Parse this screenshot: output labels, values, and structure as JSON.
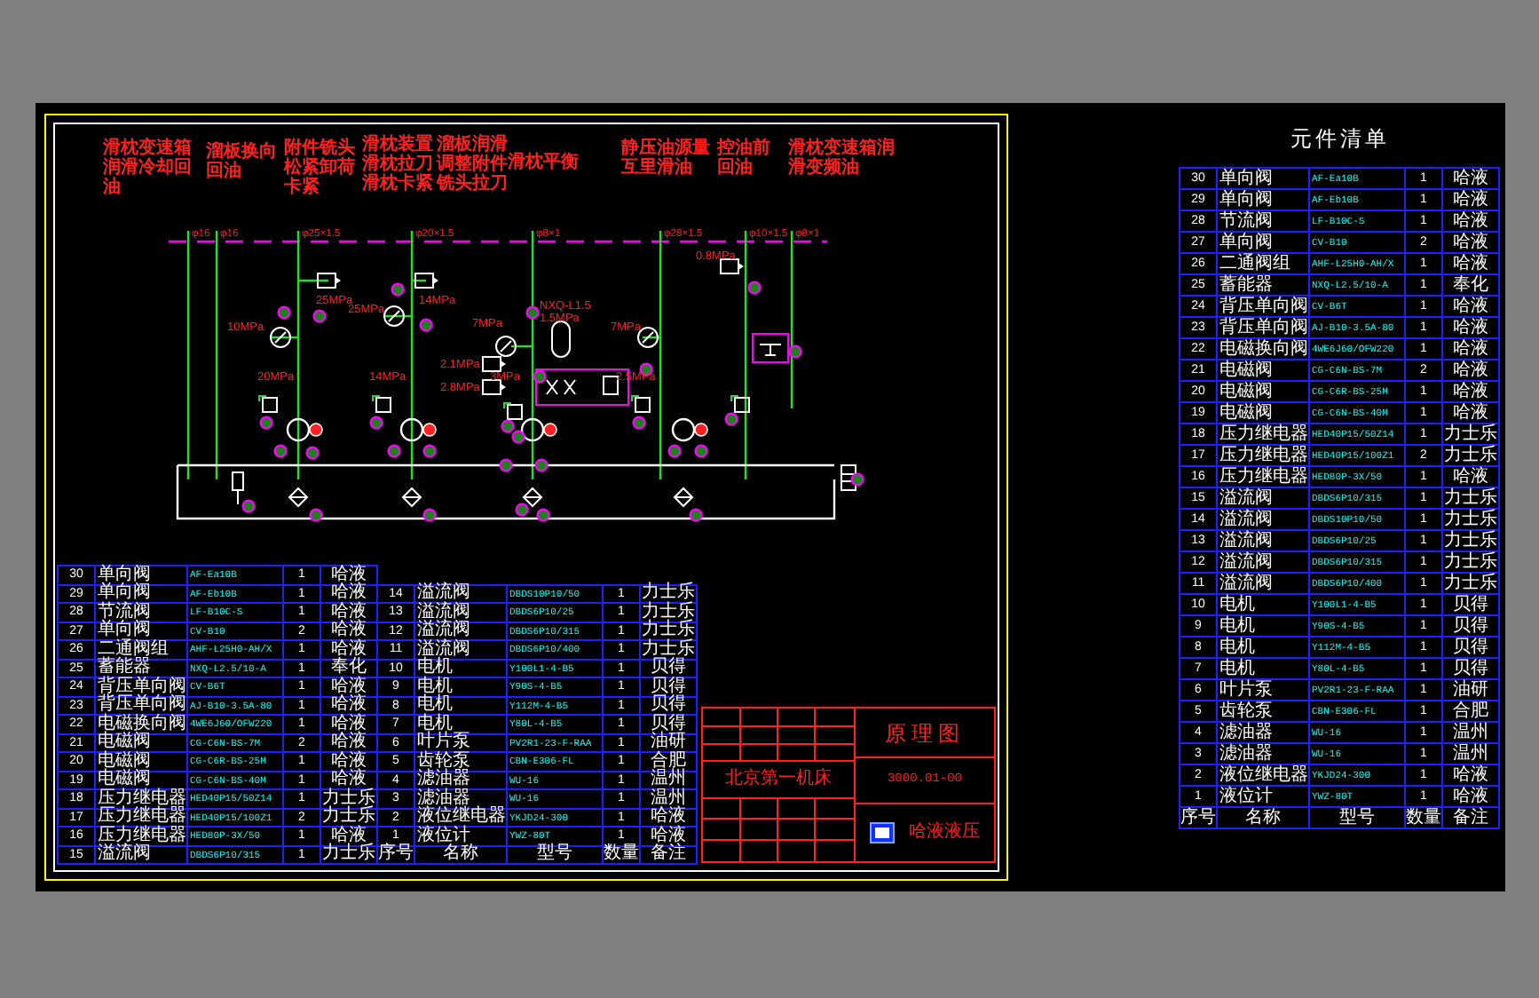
{
  "annotations": [
    "滑枕变速箱润滑冷却回油",
    "溜板换向回油",
    "附件铣头松紧卸荷卡紧",
    "滑枕装置滑枕拉刀滑枕卡紧",
    "溜板润滑调整附件铣头拉刀",
    "滑枕平衡",
    "静压油源量互里滑油",
    "控油前回油",
    "滑枕变速箱润滑变频油"
  ],
  "pipe_sizes": [
    "φ16",
    "φ16",
    "φ25×1.5",
    "φ20×1.5",
    "φ8×1",
    "φ28×1.5",
    "φ10×1.5",
    "φ8×1"
  ],
  "pressure_labels": [
    "25MPa",
    "14MPa",
    "10MPa",
    "25MPa",
    "7MPa",
    "NXQ-L1.5",
    "1.5MPa",
    "7MPa",
    "2.1MPa",
    "2.8MPa",
    "20MPa",
    "14MPa",
    "3MPa",
    "2.5MPa",
    "0.8MPa"
  ],
  "parts_table": {
    "columns": [
      "序号",
      "名称",
      "型号",
      "数量",
      "备注"
    ],
    "rows": [
      {
        "no": "30",
        "name": "单向阀",
        "model": "AF-Ea10B",
        "qty": "1",
        "note": "哈液"
      },
      {
        "no": "29",
        "name": "单向阀",
        "model": "AF-Eb10B",
        "qty": "1",
        "note": "哈液"
      },
      {
        "no": "28",
        "name": "节流阀",
        "model": "LF-B10C-S",
        "qty": "1",
        "note": "哈液"
      },
      {
        "no": "27",
        "name": "单向阀",
        "model": "CV-B10",
        "qty": "2",
        "note": "哈液"
      },
      {
        "no": "26",
        "name": "二通阀组",
        "model": "AHF-L25H0-AH/X",
        "qty": "1",
        "note": "哈液"
      },
      {
        "no": "25",
        "name": "蓄能器",
        "model": "NXQ-L2.5/10-A",
        "qty": "1",
        "note": "奉化"
      },
      {
        "no": "24",
        "name": "背压单向阀",
        "model": "CV-B6T",
        "qty": "1",
        "note": "哈液"
      },
      {
        "no": "23",
        "name": "背压单向阀",
        "model": "AJ-B10-3.5A-80",
        "qty": "1",
        "note": "哈液"
      },
      {
        "no": "22",
        "name": "电磁换向阀",
        "model": "4WE6J60/OFW220",
        "qty": "1",
        "note": "哈液"
      },
      {
        "no": "21",
        "name": "电磁阀",
        "model": "CG-C6N-BS-7M",
        "qty": "2",
        "note": "哈液"
      },
      {
        "no": "20",
        "name": "电磁阀",
        "model": "CG-C6R-BS-25M",
        "qty": "1",
        "note": "哈液"
      },
      {
        "no": "19",
        "name": "电磁阀",
        "model": "CG-C6N-BS-40M",
        "qty": "1",
        "note": "哈液"
      },
      {
        "no": "18",
        "name": "压力继电器",
        "model": "HED40P15/50Z14",
        "qty": "1",
        "note": "力士乐"
      },
      {
        "no": "17",
        "name": "压力继电器",
        "model": "HED40P15/100Z1",
        "qty": "2",
        "note": "力士乐"
      },
      {
        "no": "16",
        "name": "压力继电器",
        "model": "HED80P-3X/50",
        "qty": "1",
        "note": "哈液"
      },
      {
        "no": "15",
        "name": "溢流阀",
        "model": "DBDS6P10/315",
        "qty": "1",
        "note": "力士乐"
      },
      {
        "no": "14",
        "name": "溢流阀",
        "model": "DBDS10P10/50",
        "qty": "1",
        "note": "力士乐"
      },
      {
        "no": "13",
        "name": "溢流阀",
        "model": "DBDS6P10/25",
        "qty": "1",
        "note": "力士乐"
      },
      {
        "no": "12",
        "name": "溢流阀",
        "model": "DBDS6P10/315",
        "qty": "1",
        "note": "力士乐"
      },
      {
        "no": "11",
        "name": "溢流阀",
        "model": "DBDS6P10/400",
        "qty": "1",
        "note": "力士乐"
      },
      {
        "no": "10",
        "name": "电机",
        "model": "Y100L1-4-B5",
        "qty": "1",
        "note": "贝得"
      },
      {
        "no": "9",
        "name": "电机",
        "model": "Y90S-4-B5",
        "qty": "1",
        "note": "贝得"
      },
      {
        "no": "8",
        "name": "电机",
        "model": "Y112M-4-B5",
        "qty": "1",
        "note": "贝得"
      },
      {
        "no": "7",
        "name": "电机",
        "model": "Y80L-4-B5",
        "qty": "1",
        "note": "贝得"
      },
      {
        "no": "6",
        "name": "叶片泵",
        "model": "PV2R1-23-F-RAA",
        "qty": "1",
        "note": "油研"
      },
      {
        "no": "5",
        "name": "齿轮泵",
        "model": "CBN-E306-FL",
        "qty": "1",
        "note": "合肥"
      },
      {
        "no": "4",
        "name": "滤油器",
        "model": "WU-16",
        "qty": "1",
        "note": "温州"
      },
      {
        "no": "3",
        "name": "滤油器",
        "model": "WU-16",
        "qty": "1",
        "note": "温州"
      },
      {
        "no": "2",
        "name": "液位继电器",
        "model": "YKJD24-300",
        "qty": "1",
        "note": "哈液"
      },
      {
        "no": "1",
        "name": "液位计",
        "model": "YWZ-80T",
        "qty": "1",
        "note": "哈液"
      }
    ]
  },
  "title_block": {
    "drawing_name": "原理图",
    "company": "北京第一机床",
    "code": "3000.01-00",
    "maker": "哈液液压"
  },
  "parts_list": {
    "title": "元件清单",
    "columns": [
      "序号",
      "名称",
      "型号",
      "数量",
      "备注"
    ],
    "rows": [
      {
        "no": "30",
        "name": "单向阀",
        "model": "AF-Ea10B",
        "qty": "1",
        "note": "哈液"
      },
      {
        "no": "29",
        "name": "单向阀",
        "model": "AF-Eb10B",
        "qty": "1",
        "note": "哈液"
      },
      {
        "no": "28",
        "name": "节流阀",
        "model": "LF-B10C-S",
        "qty": "1",
        "note": "哈液"
      },
      {
        "no": "27",
        "name": "单向阀",
        "model": "CV-B10",
        "qty": "2",
        "note": "哈液"
      },
      {
        "no": "26",
        "name": "二通阀组",
        "model": "AHF-L25H0-AH/X",
        "qty": "1",
        "note": "哈液"
      },
      {
        "no": "25",
        "name": "蓄能器",
        "model": "NXQ-L2.5/10-A",
        "qty": "1",
        "note": "奉化"
      },
      {
        "no": "24",
        "name": "背压单向阀",
        "model": "CV-B6T",
        "qty": "1",
        "note": "哈液"
      },
      {
        "no": "23",
        "name": "背压单向阀",
        "model": "AJ-B10-3.5A-80",
        "qty": "1",
        "note": "哈液"
      },
      {
        "no": "22",
        "name": "电磁换向阀",
        "model": "4WE6J60/OFW220",
        "qty": "1",
        "note": "哈液"
      },
      {
        "no": "21",
        "name": "电磁阀",
        "model": "CG-C6N-BS-7M",
        "qty": "2",
        "note": "哈液"
      },
      {
        "no": "20",
        "name": "电磁阀",
        "model": "CG-C6R-BS-25M",
        "qty": "1",
        "note": "哈液"
      },
      {
        "no": "19",
        "name": "电磁阀",
        "model": "CG-C6N-BS-40M",
        "qty": "1",
        "note": "哈液"
      },
      {
        "no": "18",
        "name": "压力继电器",
        "model": "HED40P15/50Z14",
        "qty": "1",
        "note": "力士乐"
      },
      {
        "no": "17",
        "name": "压力继电器",
        "model": "HED40P15/100Z1",
        "qty": "2",
        "note": "力士乐"
      },
      {
        "no": "16",
        "name": "压力继电器",
        "model": "HED80P-3X/50",
        "qty": "1",
        "note": "哈液"
      },
      {
        "no": "15",
        "name": "溢流阀",
        "model": "DBDS6P10/315",
        "qty": "1",
        "note": "力士乐"
      },
      {
        "no": "14",
        "name": "溢流阀",
        "model": "DBDS10P10/50",
        "qty": "1",
        "note": "力士乐"
      },
      {
        "no": "13",
        "name": "溢流阀",
        "model": "DBDS6P10/25",
        "qty": "1",
        "note": "力士乐"
      },
      {
        "no": "12",
        "name": "溢流阀",
        "model": "DBDS6P10/315",
        "qty": "1",
        "note": "力士乐"
      },
      {
        "no": "11",
        "name": "溢流阀",
        "model": "DBDS6P10/400",
        "qty": "1",
        "note": "力士乐"
      },
      {
        "no": "10",
        "name": "电机",
        "model": "Y100L1-4-B5",
        "qty": "1",
        "note": "贝得"
      },
      {
        "no": "9",
        "name": "电机",
        "model": "Y90S-4-B5",
        "qty": "1",
        "note": "贝得"
      },
      {
        "no": "8",
        "name": "电机",
        "model": "Y112M-4-B5",
        "qty": "1",
        "note": "贝得"
      },
      {
        "no": "7",
        "name": "电机",
        "model": "Y80L-4-B5",
        "qty": "1",
        "note": "贝得"
      },
      {
        "no": "6",
        "name": "叶片泵",
        "model": "PV2R1-23-F-RAA",
        "qty": "1",
        "note": "油研"
      },
      {
        "no": "5",
        "name": "齿轮泵",
        "model": "CBN-E306-FL",
        "qty": "1",
        "note": "合肥"
      },
      {
        "no": "4",
        "name": "滤油器",
        "model": "WU-16",
        "qty": "1",
        "note": "温州"
      },
      {
        "no": "3",
        "name": "滤油器",
        "model": "WU-16",
        "qty": "1",
        "note": "温州"
      },
      {
        "no": "2",
        "name": "液位继电器",
        "model": "YKJD24-300",
        "qty": "1",
        "note": "哈液"
      },
      {
        "no": "1",
        "name": "液位计",
        "model": "YWZ-80T",
        "qty": "1",
        "note": "哈液"
      }
    ]
  }
}
